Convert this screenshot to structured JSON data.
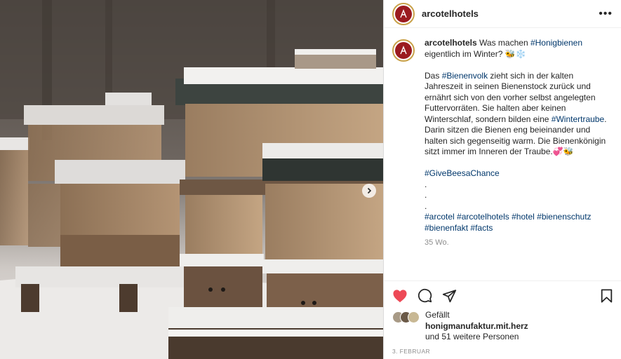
{
  "header": {
    "username": "arcotelhotels"
  },
  "caption": {
    "username": "arcotelhotels",
    "line1_pre": " Was machen ",
    "line1_tag": "#Honigbienen",
    "line1_post": " eigentlich im Winter? 🐝❄️",
    "para_pre": "Das ",
    "para_tag1": "#Bienenvolk",
    "para_mid": " zieht sich in der kalten Jahreszeit in seinen Bienenstock zurück und ernährt sich von den vorher selbst angelegten Futtervorräten. Sie halten aber keinen Winterschlaf, sondern bilden eine ",
    "para_tag2": "#Wintertraube",
    "para_post": ". Darin sitzen die Bienen eng beieinander und halten sich gegenseitig warm. Die Bienenkönigin sitzt immer im Inneren der Traube.💞🐝",
    "campaign_tag": "#GiveBeesaChance",
    "dot": ".",
    "tags": [
      "#arcotel",
      "#arcotelhotels",
      "#hotel",
      "#bienenschutz",
      "#bienenfakt",
      "#facts"
    ],
    "time": "35 Wo."
  },
  "likes": {
    "prefix": "Gefällt",
    "user": "honigmanufaktur.mit.herz",
    "rest": "und 51 weitere Personen"
  },
  "date": "3. FEBRUAR",
  "icons": {
    "like": "heart-icon",
    "comment": "comment-icon",
    "share": "share-icon",
    "save": "bookmark-icon",
    "more": "more-options-icon",
    "next": "chevron-right-icon"
  },
  "colors": {
    "like": "#ed4956",
    "hashtag": "#00376b",
    "muted": "#8e8e8e",
    "brand": "#9b1b20"
  }
}
